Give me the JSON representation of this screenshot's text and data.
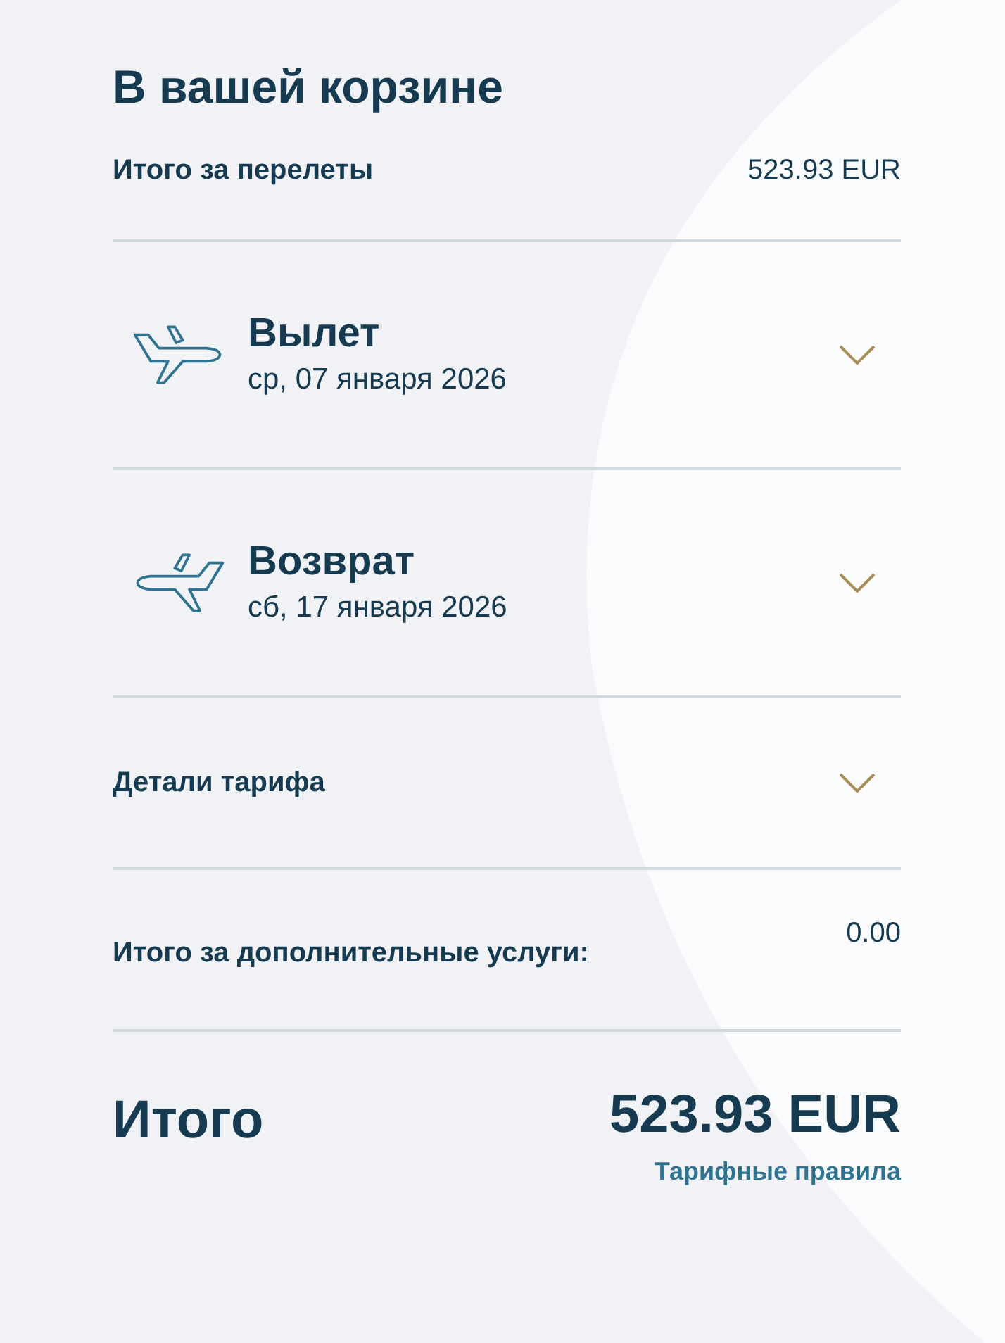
{
  "title": "В вашей корзине",
  "flights_total": {
    "label": "Итого за перелеты",
    "value": "523.93 EUR"
  },
  "sections": [
    {
      "kind": "outbound",
      "title": "Вылет",
      "date": "ср, 07 января 2026",
      "expanded": false
    },
    {
      "kind": "return",
      "title": "Возврат",
      "date": "сб, 17 января 2026",
      "expanded": false
    },
    {
      "kind": "plain",
      "title": "Детали тарифа",
      "expanded": false
    }
  ],
  "extras_total": {
    "label": "Итого за дополнительные услуги:",
    "value": "0.00"
  },
  "grand_total": {
    "label": "Итого",
    "value": "523.93 EUR",
    "link": "Тарифные правила"
  }
}
